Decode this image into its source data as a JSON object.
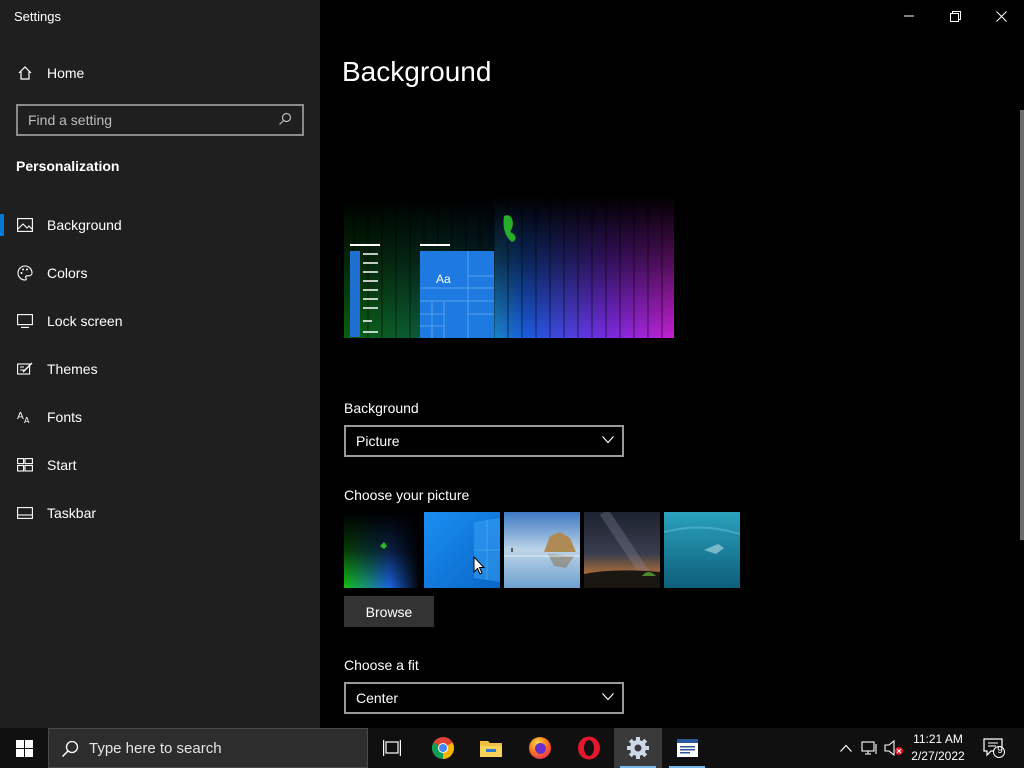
{
  "window": {
    "title": "Settings"
  },
  "sidebar": {
    "home_label": "Home",
    "search_placeholder": "Find a setting",
    "section_title": "Personalization",
    "items": [
      {
        "label": "Background",
        "icon": "picture-icon",
        "selected": true
      },
      {
        "label": "Colors",
        "icon": "palette-icon"
      },
      {
        "label": "Lock screen",
        "icon": "lock-screen-icon"
      },
      {
        "label": "Themes",
        "icon": "themes-icon"
      },
      {
        "label": "Fonts",
        "icon": "fonts-icon"
      },
      {
        "label": "Start",
        "icon": "start-icon"
      },
      {
        "label": "Taskbar",
        "icon": "taskbar-icon"
      }
    ]
  },
  "main": {
    "title": "Background",
    "preview_sample_text": "Aa",
    "background_label": "Background",
    "background_value": "Picture",
    "choose_picture_label": "Choose your picture",
    "browse_label": "Browse",
    "fit_label": "Choose a fit",
    "fit_value": "Center"
  },
  "taskbar": {
    "search_placeholder": "Type here to search",
    "apps": [
      "task-view-icon",
      "chrome-icon",
      "file-explorer-icon",
      "firefox-icon",
      "opera-icon",
      "settings-icon",
      "word-icon"
    ],
    "time": "11:21 AM",
    "date": "2/27/2022",
    "notification_count": "9"
  },
  "colors": {
    "accent": "#0078d7",
    "sidebar_bg": "#1f1f1f",
    "main_bg": "#000000"
  }
}
